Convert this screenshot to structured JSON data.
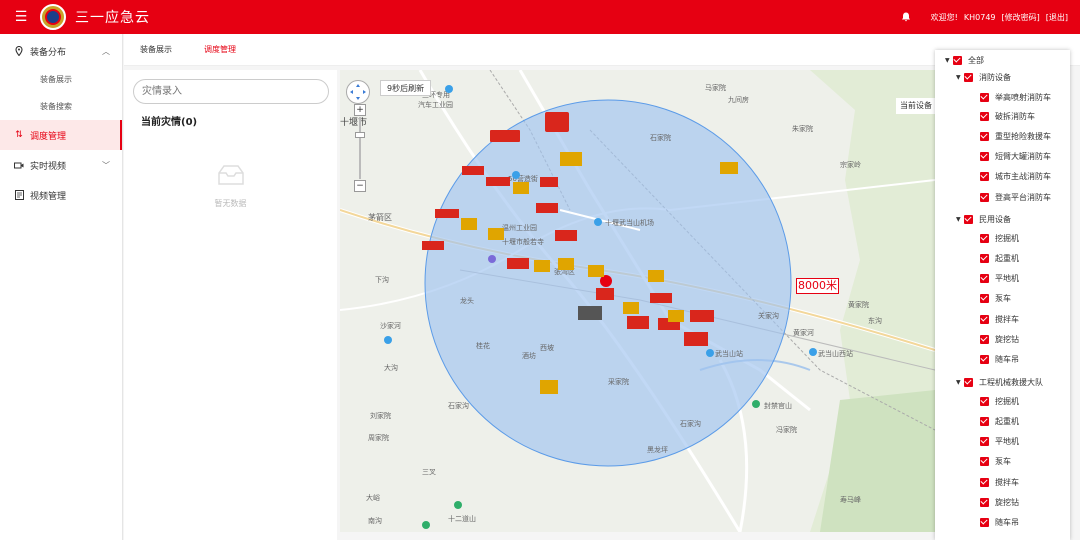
{
  "app": {
    "title": "三一应急云"
  },
  "header": {
    "welcome": "欢迎您!",
    "user": "KH0749",
    "change_password": "[修改密码]",
    "logout": "[退出]"
  },
  "sidebar": {
    "groups": [
      {
        "label": "装备分布",
        "children": [
          "装备展示",
          "装备搜索"
        ]
      },
      {
        "label": "调度管理"
      },
      {
        "label": "实时视频"
      },
      {
        "label": "视频管理"
      }
    ]
  },
  "tabs": [
    "装备展示",
    "调度管理"
  ],
  "disaster": {
    "search_placeholder": "灾情录入",
    "title": "当前灾情(0)",
    "empty": "暂无数据"
  },
  "map": {
    "refresh": "9秒后刷新",
    "current_equipment": "当前设备",
    "radius_label": "8000米",
    "places": [
      "三环专用",
      "汽车工业园",
      "十堰市",
      "50营造街",
      "温州工业园",
      "十堰市般若寺",
      "十堰武当山机场",
      "茅箭区",
      "张湾区",
      "武当山站",
      "武当山西站",
      "封禁官山",
      "十二道山",
      "寿马峰",
      "石家院",
      "宗家岭",
      "大沟",
      "下沟",
      "龙头",
      "桂花",
      "石家沟",
      "酒坊",
      "西坡",
      "采家院",
      "黑龙坪",
      "石家沟",
      "沙家河",
      "刘家院",
      "冯家院",
      "周家院",
      "黄家院",
      "大峪",
      "南沟",
      "三叉",
      "黄家河",
      "关家沟",
      "马家院",
      "九间房",
      "东沟",
      "朱家院"
    ]
  },
  "filter": {
    "all": "全部",
    "groups": [
      {
        "label": "消防设备",
        "items": [
          "举高喷射消防车",
          "破拆消防车",
          "重型抢险救援车",
          "短臂大罐消防车",
          "城市主战消防车",
          "登高平台消防车"
        ]
      },
      {
        "label": "民用设备",
        "items": [
          "挖掘机",
          "起重机",
          "平地机",
          "泵车",
          "搅拌车",
          "旋挖钻",
          "随车吊"
        ]
      },
      {
        "label": "工程机械救援大队",
        "items": [
          "挖掘机",
          "起重机",
          "平地机",
          "泵车",
          "搅拌车",
          "旋挖钻",
          "随车吊"
        ]
      }
    ]
  },
  "colors": {
    "brand": "#e60012",
    "circle_fill": "#9fc3f0",
    "circle_stroke": "#5b9be8"
  }
}
